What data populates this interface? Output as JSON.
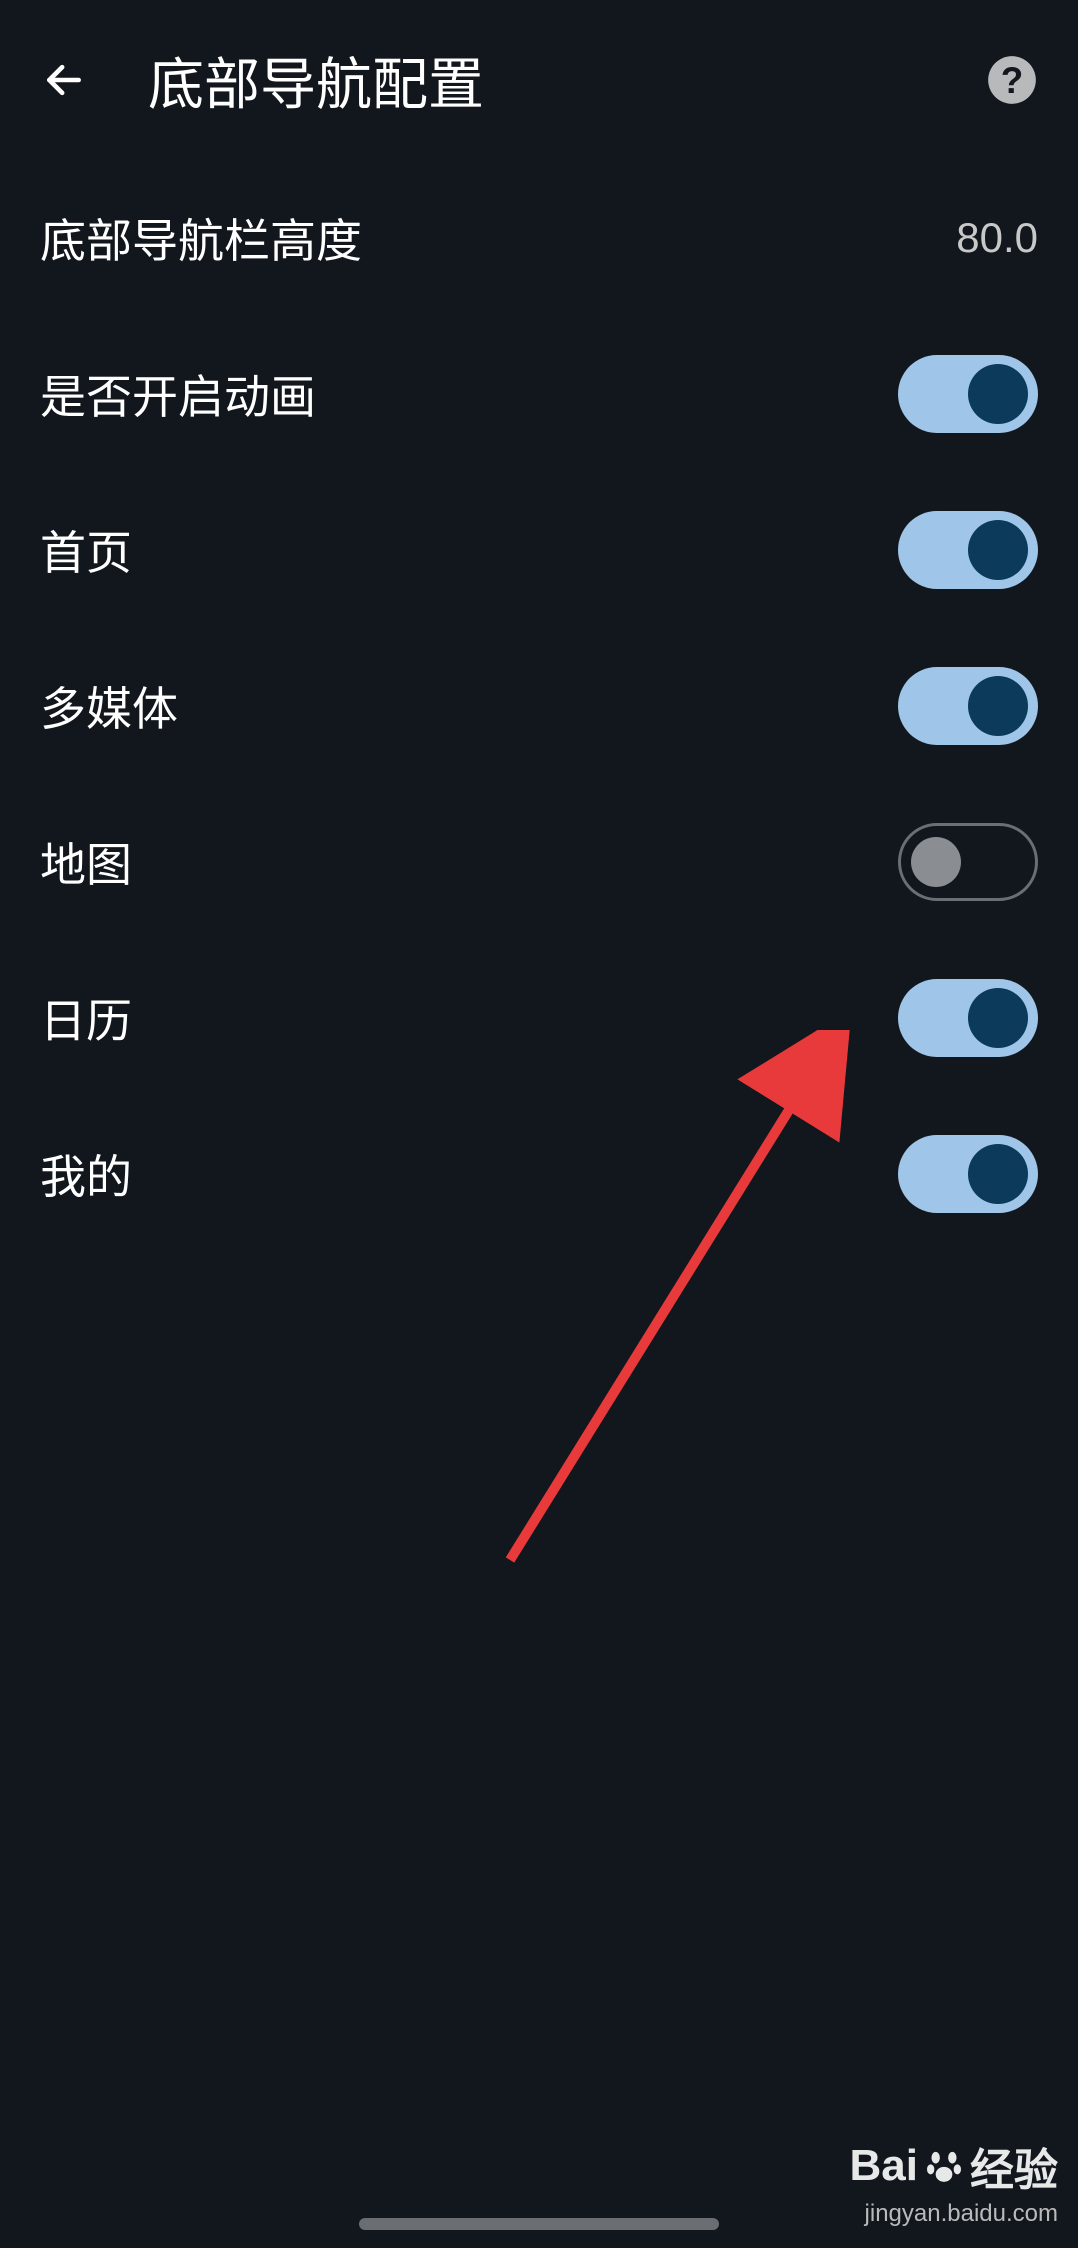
{
  "header": {
    "title": "底部导航配置"
  },
  "settings": {
    "height": {
      "label": "底部导航栏高度",
      "value": "80.0"
    },
    "animation": {
      "label": "是否开启动画",
      "enabled": true
    },
    "home": {
      "label": "首页",
      "enabled": true
    },
    "multimedia": {
      "label": "多媒体",
      "enabled": true
    },
    "map": {
      "label": "地图",
      "enabled": false
    },
    "calendar": {
      "label": "日历",
      "enabled": true
    },
    "mine": {
      "label": "我的",
      "enabled": true
    }
  },
  "watermark": {
    "brand_prefix": "Bai",
    "brand_suffix": "经验",
    "url": "jingyan.baidu.com"
  }
}
